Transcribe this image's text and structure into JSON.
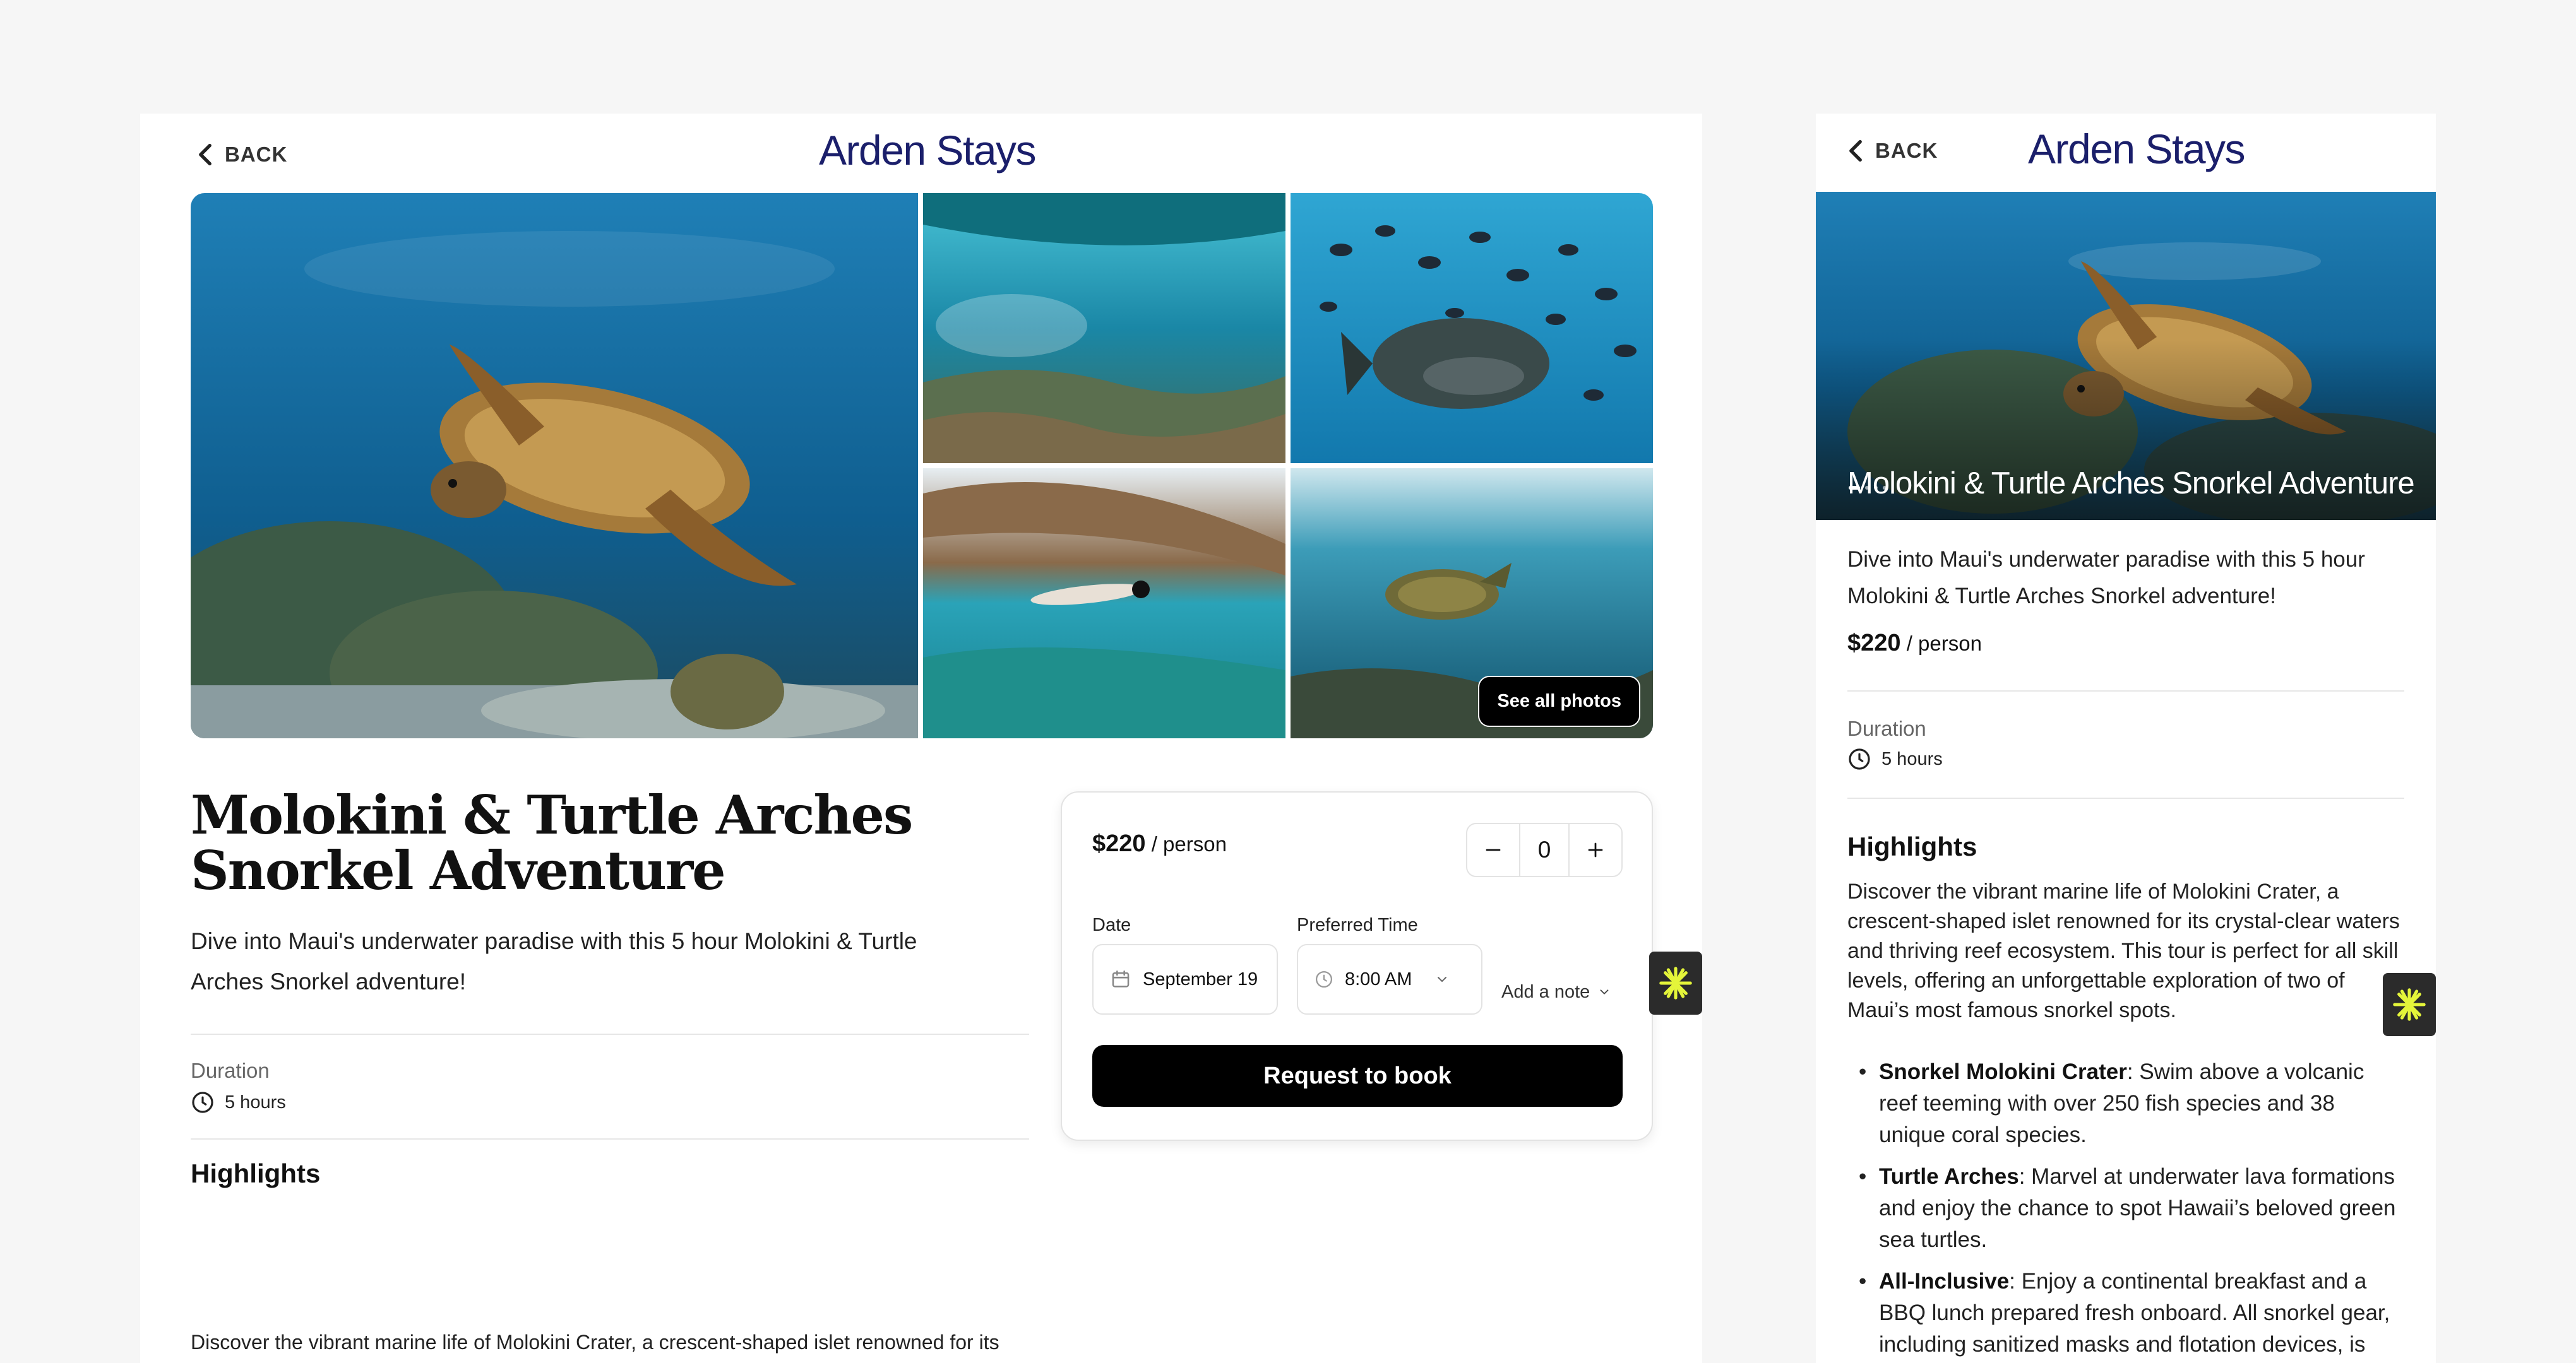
{
  "brand": "Arden Stays",
  "back_label": "BACK",
  "listing": {
    "title": "Molokini & Turtle Arches Snorkel Adventure",
    "subtitle": "Dive into Maui's underwater paradise with this 5 hour Molokini & Turtle Arches Snorkel adventure!",
    "price_amount": "$220",
    "price_unit": " / person",
    "duration_label": "Duration",
    "duration_value": "5 hours",
    "highlights_heading": "Highlights",
    "highlights_text": "Discover the vibrant marine life of Molokini Crater, a crescent-shaped islet renowned for its crystal-clear waters and thriving reef ecosystem. This tour is perfect for all skill levels, offering an unforgettable exploration of two of Maui’s most famous snorkel spots.",
    "highlights_list": [
      {
        "title": "Snorkel Molokini Crater",
        "text": ": Swim above a volcanic reef teeming with over 250 fish species and 38 unique coral species."
      },
      {
        "title": "Turtle Arches",
        "text": ": Marvel at underwater lava formations and enjoy the chance to spot Hawaii’s beloved green sea turtles."
      },
      {
        "title": "All-Inclusive",
        "text": ": Enjoy a continental breakfast and a BBQ lunch prepared fresh onboard. All snorkel gear, including sanitized masks and flotation devices, is"
      }
    ]
  },
  "gallery": {
    "see_all": "See all photos",
    "carousel_slides": 4,
    "carousel_active": 1
  },
  "booking": {
    "quantity": "0",
    "date_label": "Date",
    "date_value": "September 19",
    "time_label": "Preferred Time",
    "time_value": "8:00 AM",
    "add_note": "Add a note",
    "request_button": "Request to book"
  },
  "colors": {
    "brand": "#1b1f6b",
    "button": "#000000",
    "widget_badge": "#2b2b2b",
    "widget_accent": "#e4f53a"
  },
  "icons": [
    "chevron-left-icon",
    "clock-icon",
    "calendar-icon",
    "minus-icon",
    "plus-icon",
    "chevron-down-icon",
    "sparkle-icon"
  ]
}
